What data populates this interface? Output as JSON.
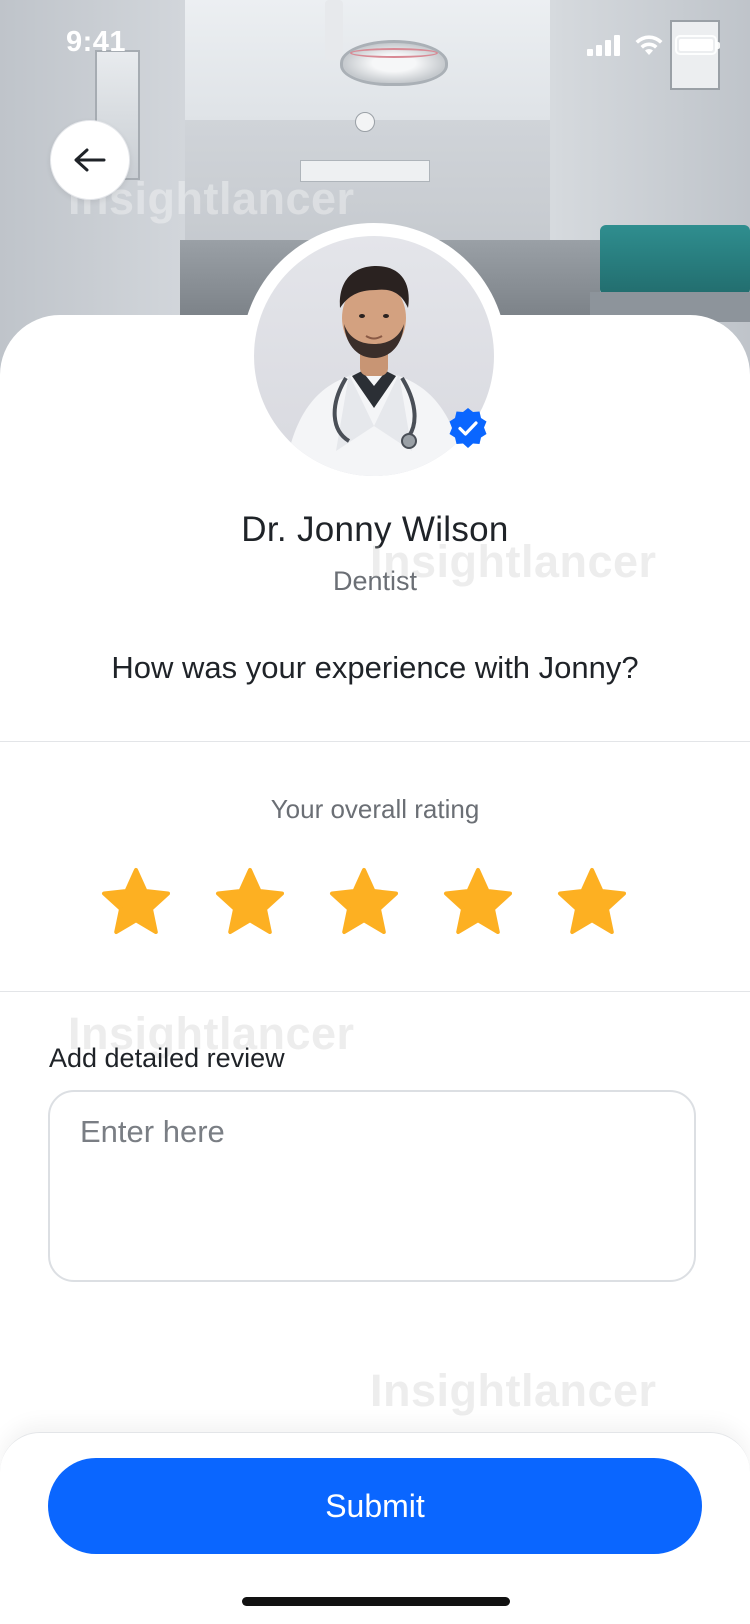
{
  "status_bar": {
    "time": "9:41"
  },
  "watermarks": [
    "Insightlancer",
    "Insightlancer",
    "Insightlancer",
    "Insightlancer"
  ],
  "doctor": {
    "name": "Dr. Jonny Wilson",
    "role": "Dentist",
    "verified": true
  },
  "question": "How was your experience with Jonny?",
  "rating": {
    "label": "Your overall rating",
    "value": 5,
    "max": 5,
    "star_color": "#FDB022"
  },
  "review": {
    "label": "Add detailed review",
    "placeholder": "Enter here",
    "value": ""
  },
  "actions": {
    "submit_label": "Submit"
  },
  "colors": {
    "primary": "#0A66FF",
    "badge": "#0A66FF"
  }
}
